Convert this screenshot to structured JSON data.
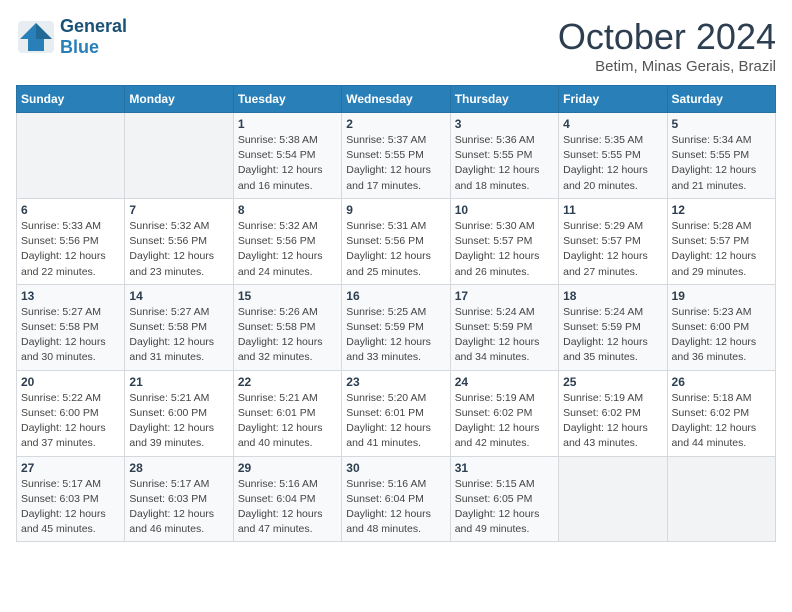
{
  "header": {
    "logo_general": "General",
    "logo_blue": "Blue",
    "month": "October 2024",
    "location": "Betim, Minas Gerais, Brazil"
  },
  "weekdays": [
    "Sunday",
    "Monday",
    "Tuesday",
    "Wednesday",
    "Thursday",
    "Friday",
    "Saturday"
  ],
  "weeks": [
    [
      {
        "day": "",
        "detail": ""
      },
      {
        "day": "",
        "detail": ""
      },
      {
        "day": "1",
        "detail": "Sunrise: 5:38 AM\nSunset: 5:54 PM\nDaylight: 12 hours and 16 minutes."
      },
      {
        "day": "2",
        "detail": "Sunrise: 5:37 AM\nSunset: 5:55 PM\nDaylight: 12 hours and 17 minutes."
      },
      {
        "day": "3",
        "detail": "Sunrise: 5:36 AM\nSunset: 5:55 PM\nDaylight: 12 hours and 18 minutes."
      },
      {
        "day": "4",
        "detail": "Sunrise: 5:35 AM\nSunset: 5:55 PM\nDaylight: 12 hours and 20 minutes."
      },
      {
        "day": "5",
        "detail": "Sunrise: 5:34 AM\nSunset: 5:55 PM\nDaylight: 12 hours and 21 minutes."
      }
    ],
    [
      {
        "day": "6",
        "detail": "Sunrise: 5:33 AM\nSunset: 5:56 PM\nDaylight: 12 hours and 22 minutes."
      },
      {
        "day": "7",
        "detail": "Sunrise: 5:32 AM\nSunset: 5:56 PM\nDaylight: 12 hours and 23 minutes."
      },
      {
        "day": "8",
        "detail": "Sunrise: 5:32 AM\nSunset: 5:56 PM\nDaylight: 12 hours and 24 minutes."
      },
      {
        "day": "9",
        "detail": "Sunrise: 5:31 AM\nSunset: 5:56 PM\nDaylight: 12 hours and 25 minutes."
      },
      {
        "day": "10",
        "detail": "Sunrise: 5:30 AM\nSunset: 5:57 PM\nDaylight: 12 hours and 26 minutes."
      },
      {
        "day": "11",
        "detail": "Sunrise: 5:29 AM\nSunset: 5:57 PM\nDaylight: 12 hours and 27 minutes."
      },
      {
        "day": "12",
        "detail": "Sunrise: 5:28 AM\nSunset: 5:57 PM\nDaylight: 12 hours and 29 minutes."
      }
    ],
    [
      {
        "day": "13",
        "detail": "Sunrise: 5:27 AM\nSunset: 5:58 PM\nDaylight: 12 hours and 30 minutes."
      },
      {
        "day": "14",
        "detail": "Sunrise: 5:27 AM\nSunset: 5:58 PM\nDaylight: 12 hours and 31 minutes."
      },
      {
        "day": "15",
        "detail": "Sunrise: 5:26 AM\nSunset: 5:58 PM\nDaylight: 12 hours and 32 minutes."
      },
      {
        "day": "16",
        "detail": "Sunrise: 5:25 AM\nSunset: 5:59 PM\nDaylight: 12 hours and 33 minutes."
      },
      {
        "day": "17",
        "detail": "Sunrise: 5:24 AM\nSunset: 5:59 PM\nDaylight: 12 hours and 34 minutes."
      },
      {
        "day": "18",
        "detail": "Sunrise: 5:24 AM\nSunset: 5:59 PM\nDaylight: 12 hours and 35 minutes."
      },
      {
        "day": "19",
        "detail": "Sunrise: 5:23 AM\nSunset: 6:00 PM\nDaylight: 12 hours and 36 minutes."
      }
    ],
    [
      {
        "day": "20",
        "detail": "Sunrise: 5:22 AM\nSunset: 6:00 PM\nDaylight: 12 hours and 37 minutes."
      },
      {
        "day": "21",
        "detail": "Sunrise: 5:21 AM\nSunset: 6:00 PM\nDaylight: 12 hours and 39 minutes."
      },
      {
        "day": "22",
        "detail": "Sunrise: 5:21 AM\nSunset: 6:01 PM\nDaylight: 12 hours and 40 minutes."
      },
      {
        "day": "23",
        "detail": "Sunrise: 5:20 AM\nSunset: 6:01 PM\nDaylight: 12 hours and 41 minutes."
      },
      {
        "day": "24",
        "detail": "Sunrise: 5:19 AM\nSunset: 6:02 PM\nDaylight: 12 hours and 42 minutes."
      },
      {
        "day": "25",
        "detail": "Sunrise: 5:19 AM\nSunset: 6:02 PM\nDaylight: 12 hours and 43 minutes."
      },
      {
        "day": "26",
        "detail": "Sunrise: 5:18 AM\nSunset: 6:02 PM\nDaylight: 12 hours and 44 minutes."
      }
    ],
    [
      {
        "day": "27",
        "detail": "Sunrise: 5:17 AM\nSunset: 6:03 PM\nDaylight: 12 hours and 45 minutes."
      },
      {
        "day": "28",
        "detail": "Sunrise: 5:17 AM\nSunset: 6:03 PM\nDaylight: 12 hours and 46 minutes."
      },
      {
        "day": "29",
        "detail": "Sunrise: 5:16 AM\nSunset: 6:04 PM\nDaylight: 12 hours and 47 minutes."
      },
      {
        "day": "30",
        "detail": "Sunrise: 5:16 AM\nSunset: 6:04 PM\nDaylight: 12 hours and 48 minutes."
      },
      {
        "day": "31",
        "detail": "Sunrise: 5:15 AM\nSunset: 6:05 PM\nDaylight: 12 hours and 49 minutes."
      },
      {
        "day": "",
        "detail": ""
      },
      {
        "day": "",
        "detail": ""
      }
    ]
  ]
}
